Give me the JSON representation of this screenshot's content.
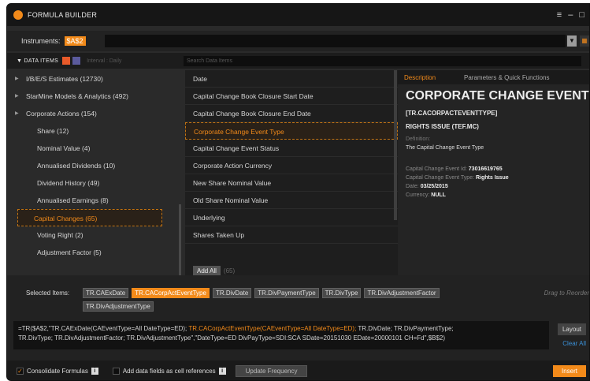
{
  "window": {
    "title": "FORMULA BUILDER"
  },
  "instruments": {
    "label": "Instruments:",
    "tag": "$A$2"
  },
  "data_items": {
    "label": "DATA ITEMS",
    "interval_label": "Interval",
    "interval_value": "Daily",
    "search_placeholder": "Search Data Items"
  },
  "tree": [
    {
      "label": "I/B/E/S Estimates (12730)",
      "level": 0
    },
    {
      "label": "StarMine Models & Analytics (492)",
      "level": 0
    },
    {
      "label": "Corporate Actions (154)",
      "level": 0
    },
    {
      "label": "Share (12)",
      "level": 1
    },
    {
      "label": "Nominal Value (4)",
      "level": 1
    },
    {
      "label": "Annualised Dividends (10)",
      "level": 1
    },
    {
      "label": "Dividend History (49)",
      "level": 1
    },
    {
      "label": "Annualised Earnings (8)",
      "level": 1
    },
    {
      "label": "Capital Changes (65)",
      "level": 1,
      "selected": true
    },
    {
      "label": "Voting Right (2)",
      "level": 1
    },
    {
      "label": "Adjustment Factor (5)",
      "level": 1
    }
  ],
  "middle": {
    "items": [
      "Date",
      "Capital Change Book Closure Start Date",
      "Capital Change Book Closure End Date",
      "Corporate Change Event Type",
      "Capital Change Event Status",
      "Corporate Action Currency",
      "New Share Nominal Value",
      "Old Share Nominal Value",
      "Underlying",
      "Shares Taken Up"
    ],
    "add_all_label": "Add All",
    "add_all_count": "(65)"
  },
  "detail": {
    "tab_description": "Description",
    "tab_parameters": "Parameters & Quick Functions",
    "title": "CORPORATE CHANGE EVENT TYPE",
    "code": "[TR.CACORPACTEVENTTYPE]",
    "subtitle": "RIGHTS ISSUE (TEF.MC)",
    "definition_label": "Definition:",
    "definition": "The Capital Change Event Type",
    "kv": [
      {
        "k": "Capital Change Event Id:",
        "v": "73016619765"
      },
      {
        "k": "Capital Change Event Type:",
        "v": "Rights Issue"
      },
      {
        "k": "Date:",
        "v": "03/25/2015"
      },
      {
        "k": "Currency:",
        "v": "NULL"
      }
    ]
  },
  "selected": {
    "label": "Selected Items:",
    "chips": [
      {
        "text": "TR.CAExDate",
        "active": false
      },
      {
        "text": "TR.CACorpActEventType",
        "active": true
      },
      {
        "text": "TR.DivDate",
        "active": false
      },
      {
        "text": "TR.DivPaymentType",
        "active": false
      },
      {
        "text": "TR.DivType",
        "active": false
      },
      {
        "text": "TR.DivAdjustmentFactor",
        "active": false
      },
      {
        "text": "TR.DivAdjustmentType",
        "active": false
      }
    ],
    "drag_hint": "Drag to Reorder"
  },
  "formula": {
    "part1": "=TR($A$2,\"TR.CAExDate(CAEventType=All DateType=ED); ",
    "part2": "TR.CACorpActEventType(CAEventType=All DateType=ED);",
    "part3": " TR.DivDate; TR.DivPaymentType;",
    "line2": "TR.DivType; TR.DivAdjustmentFactor; TR.DivAdjustmentType\",\"DateType=ED DivPayType=SDI:SCA SDate=20151030 EDate=20000101 CH=Fd\",$B$2)"
  },
  "buttons": {
    "layout": "Layout",
    "clear_all": "Clear All",
    "update_frequency": "Update Frequency",
    "insert": "Insert"
  },
  "footer": {
    "consolidate": "Consolidate Formulas",
    "add_fields": "Add data fields as cell references"
  },
  "colors": {
    "accent": "#f28a1a",
    "link": "#3a8fd6"
  }
}
